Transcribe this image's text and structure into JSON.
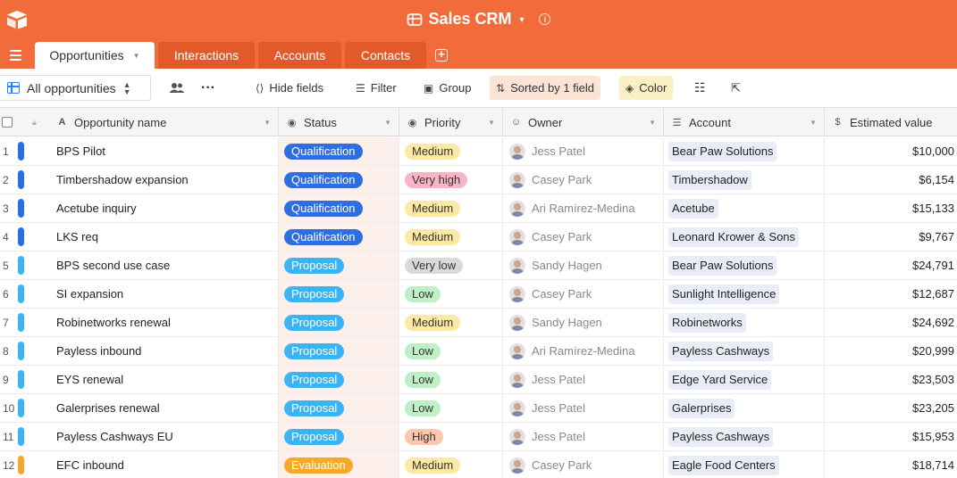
{
  "app": {
    "base_name": "Sales CRM",
    "colors": {
      "brand": "#f26b3a",
      "tab_inactive": "#e35a2a"
    }
  },
  "tabs": [
    {
      "label": "Opportunities",
      "active": true
    },
    {
      "label": "Interactions",
      "active": false
    },
    {
      "label": "Accounts",
      "active": false
    },
    {
      "label": "Contacts",
      "active": false
    }
  ],
  "toolbar": {
    "view_name": "All opportunities",
    "hide_fields": "Hide fields",
    "filter": "Filter",
    "group": "Group",
    "sorted": "Sorted by 1 field",
    "color": "Color"
  },
  "columns": {
    "name": "Opportunity name",
    "status": "Status",
    "priority": "Priority",
    "owner": "Owner",
    "account": "Account",
    "value": "Estimated value"
  },
  "rows": [
    {
      "num": "1",
      "name": "BPS Pilot",
      "status": "Qualification",
      "priority": "Medium",
      "owner": "Jess Patel",
      "account": "Bear Paw Solutions",
      "value": "$10,000"
    },
    {
      "num": "2",
      "name": "Timbershadow expansion",
      "status": "Qualification",
      "priority": "Very high",
      "owner": "Casey Park",
      "account": "Timbershadow",
      "value": "$6,154"
    },
    {
      "num": "3",
      "name": "Acetube inquiry",
      "status": "Qualification",
      "priority": "Medium",
      "owner": "Ari Ramírez-Medina",
      "account": "Acetube",
      "value": "$15,133"
    },
    {
      "num": "4",
      "name": "LKS req",
      "status": "Qualification",
      "priority": "Medium",
      "owner": "Casey Park",
      "account": "Leonard Krower & Sons",
      "value": "$9,767"
    },
    {
      "num": "5",
      "name": "BPS second use case",
      "status": "Proposal",
      "priority": "Very low",
      "owner": "Sandy Hagen",
      "account": "Bear Paw Solutions",
      "value": "$24,791"
    },
    {
      "num": "6",
      "name": "SI expansion",
      "status": "Proposal",
      "priority": "Low",
      "owner": "Casey Park",
      "account": "Sunlight Intelligence",
      "value": "$12,687"
    },
    {
      "num": "7",
      "name": "Robinetworks renewal",
      "status": "Proposal",
      "priority": "Medium",
      "owner": "Sandy Hagen",
      "account": "Robinetworks",
      "value": "$24,692"
    },
    {
      "num": "8",
      "name": "Payless inbound",
      "status": "Proposal",
      "priority": "Low",
      "owner": "Ari Ramírez-Medina",
      "account": "Payless Cashways",
      "value": "$20,999"
    },
    {
      "num": "9",
      "name": "EYS renewal",
      "status": "Proposal",
      "priority": "Low",
      "owner": "Jess Patel",
      "account": "Edge Yard Service",
      "value": "$23,503"
    },
    {
      "num": "10",
      "name": "Galerprises renewal",
      "status": "Proposal",
      "priority": "Low",
      "owner": "Jess Patel",
      "account": "Galerprises",
      "value": "$23,205"
    },
    {
      "num": "11",
      "name": "Payless Cashways EU",
      "status": "Proposal",
      "priority": "High",
      "owner": "Jess Patel",
      "account": "Payless Cashways",
      "value": "$15,953"
    },
    {
      "num": "12",
      "name": "EFC inbound",
      "status": "Evaluation",
      "priority": "Medium",
      "owner": "Casey Park",
      "account": "Eagle Food Centers",
      "value": "$18,714"
    }
  ],
  "status_colors": {
    "Qualification": "#2d6fe0",
    "Proposal": "#3cb4f2",
    "Evaluation": "#f4a92a"
  }
}
